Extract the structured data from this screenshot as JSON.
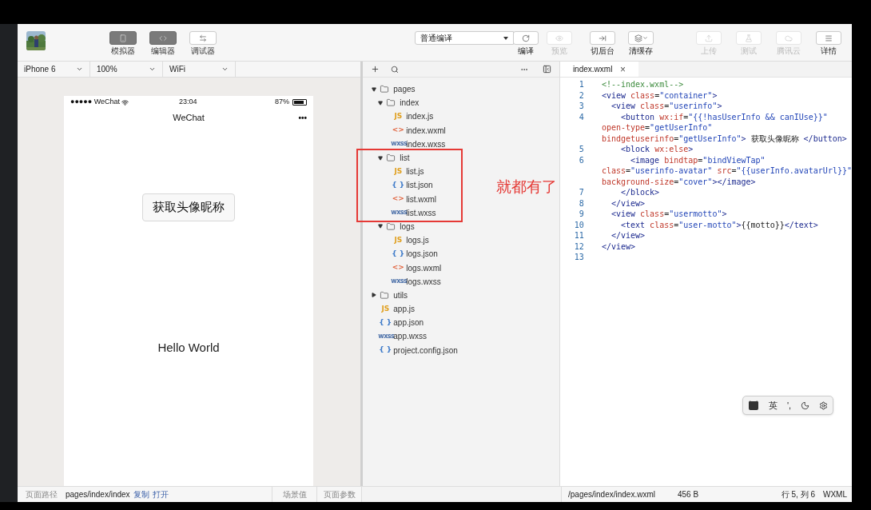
{
  "toolbar": {
    "views": [
      {
        "label": "模拟器",
        "on": true
      },
      {
        "label": "编辑器",
        "on": true
      },
      {
        "label": "调试器",
        "on": false
      }
    ],
    "compile_mode": "普通编译",
    "actions": [
      {
        "label": "编译",
        "disabled": false
      },
      {
        "label": "预览",
        "disabled": true
      },
      {
        "label": "切后台",
        "disabled": false
      },
      {
        "label": "清缓存",
        "disabled": false
      }
    ],
    "cloud": [
      {
        "label": "上传",
        "disabled": true
      },
      {
        "label": "测试",
        "disabled": true
      },
      {
        "label": "腾讯云",
        "disabled": true
      },
      {
        "label": "详情",
        "disabled": false
      }
    ]
  },
  "simulator": {
    "selects": [
      "iPhone 6",
      "100%",
      "WiFi"
    ],
    "phone": {
      "carrier": "●●●●● WeChat",
      "time": "23:04",
      "battery": "87%",
      "nav_title": "WeChat",
      "nav_more": "•••",
      "button": "获取头像昵称",
      "text": "Hello World"
    },
    "status": {
      "label": "页面路径",
      "path": "pages/index/index",
      "links": [
        "复制",
        "打开"
      ],
      "scene": "场景值",
      "params": "页面参数"
    }
  },
  "file_tree": [
    {
      "name": "pages",
      "kind": "folder",
      "expanded": true,
      "children": [
        {
          "name": "index",
          "kind": "folder",
          "expanded": true,
          "children": [
            {
              "name": "index.js",
              "kind": "js",
              "badge": "JS"
            },
            {
              "name": "index.wxml",
              "kind": "wxml",
              "badge": "<>"
            },
            {
              "name": "index.wxss",
              "kind": "wxss",
              "badge": "wxss"
            }
          ]
        },
        {
          "name": "list",
          "kind": "folder",
          "expanded": true,
          "children": [
            {
              "name": "list.js",
              "kind": "js",
              "badge": "JS"
            },
            {
              "name": "list.json",
              "kind": "json",
              "badge": "{ }"
            },
            {
              "name": "list.wxml",
              "kind": "wxml",
              "badge": "<>"
            },
            {
              "name": "list.wxss",
              "kind": "wxss",
              "badge": "wxss"
            }
          ]
        },
        {
          "name": "logs",
          "kind": "folder",
          "expanded": true,
          "children": [
            {
              "name": "logs.js",
              "kind": "js",
              "badge": "JS"
            },
            {
              "name": "logs.json",
              "kind": "json",
              "badge": "{ }"
            },
            {
              "name": "logs.wxml",
              "kind": "wxml",
              "badge": "<>"
            },
            {
              "name": "logs.wxss",
              "kind": "wxss",
              "badge": "wxss"
            }
          ]
        }
      ]
    },
    {
      "name": "utils",
      "kind": "folder",
      "expanded": false
    },
    {
      "name": "app.js",
      "kind": "js",
      "badge": "JS"
    },
    {
      "name": "app.json",
      "kind": "json",
      "badge": "{ }"
    },
    {
      "name": "app.wxss",
      "kind": "wxss",
      "badge": "wxss"
    },
    {
      "name": "project.config.json",
      "kind": "json",
      "badge": "{ }"
    }
  ],
  "annotation": {
    "text": "就都有了"
  },
  "editor": {
    "tab": {
      "title": "index.wxml",
      "close": "×"
    },
    "lines": [
      {
        "number": "1",
        "tokens": [
          {
            "kind": "comment",
            "text": "<!--index.wxml-->"
          }
        ]
      },
      {
        "number": "2",
        "tokens": [
          {
            "kind": "tag",
            "text": "<view "
          },
          {
            "kind": "attr",
            "text": "class"
          },
          {
            "kind": "plain",
            "text": "="
          },
          {
            "kind": "string",
            "text": "\"container\""
          },
          {
            "kind": "tag",
            "text": ">"
          }
        ]
      },
      {
        "number": "3",
        "tokens": [
          {
            "kind": "tag",
            "text": "  <view "
          },
          {
            "kind": "attr",
            "text": "class"
          },
          {
            "kind": "plain",
            "text": "="
          },
          {
            "kind": "string",
            "text": "\"userinfo\""
          },
          {
            "kind": "tag",
            "text": ">"
          }
        ]
      },
      {
        "number": "4",
        "tokens": [
          {
            "kind": "tag",
            "text": "    <button "
          },
          {
            "kind": "attr",
            "text": "wx:if"
          },
          {
            "kind": "plain",
            "text": "="
          },
          {
            "kind": "string",
            "text": "\"{{!hasUserInfo && canIUse}}\""
          }
        ]
      },
      {
        "tokens": [
          {
            "kind": "attr",
            "text": "open-type"
          },
          {
            "kind": "plain",
            "text": "="
          },
          {
            "kind": "string",
            "text": "\"getUserInfo\""
          }
        ]
      },
      {
        "tokens": [
          {
            "kind": "attr",
            "text": "bindgetuserinfo"
          },
          {
            "kind": "plain",
            "text": "="
          },
          {
            "kind": "string",
            "text": "\"getUserInfo\""
          },
          {
            "kind": "tag",
            "text": ">"
          },
          {
            "kind": "plain",
            "text": " 获取头像昵称 "
          },
          {
            "kind": "tag",
            "text": "</button>"
          }
        ]
      },
      {
        "number": "5",
        "tokens": [
          {
            "kind": "tag",
            "text": "    <block "
          },
          {
            "kind": "attr",
            "text": "wx:else"
          },
          {
            "kind": "tag",
            "text": ">"
          }
        ]
      },
      {
        "number": "6",
        "tokens": [
          {
            "kind": "tag",
            "text": "      <image "
          },
          {
            "kind": "attr",
            "text": "bindtap"
          },
          {
            "kind": "plain",
            "text": "="
          },
          {
            "kind": "string",
            "text": "\"bindViewTap\""
          }
        ]
      },
      {
        "tokens": [
          {
            "kind": "attr",
            "text": "class"
          },
          {
            "kind": "plain",
            "text": "="
          },
          {
            "kind": "string",
            "text": "\"userinfo-avatar\" "
          },
          {
            "kind": "attr",
            "text": "src"
          },
          {
            "kind": "plain",
            "text": "="
          },
          {
            "kind": "string",
            "text": "\"{{userInfo.avatarUrl}}\""
          }
        ]
      },
      {
        "tokens": [
          {
            "kind": "attr",
            "text": "background-size"
          },
          {
            "kind": "plain",
            "text": "="
          },
          {
            "kind": "string",
            "text": "\"cover\""
          },
          {
            "kind": "tag",
            "text": "></image>"
          }
        ]
      },
      {
        "number": "7",
        "tokens": [
          {
            "kind": "tag",
            "text": "    </block>"
          }
        ]
      },
      {
        "number": "8",
        "tokens": [
          {
            "kind": "tag",
            "text": "  </view>"
          }
        ]
      },
      {
        "number": "9",
        "tokens": [
          {
            "kind": "tag",
            "text": "  <view "
          },
          {
            "kind": "attr",
            "text": "class"
          },
          {
            "kind": "plain",
            "text": "="
          },
          {
            "kind": "string",
            "text": "\"usermotto\""
          },
          {
            "kind": "tag",
            "text": ">"
          }
        ]
      },
      {
        "number": "10",
        "tokens": [
          {
            "kind": "tag",
            "text": "    <text "
          },
          {
            "kind": "attr",
            "text": "class"
          },
          {
            "kind": "plain",
            "text": "="
          },
          {
            "kind": "string",
            "text": "\"user-motto\""
          },
          {
            "kind": "tag",
            "text": ">"
          },
          {
            "kind": "plain",
            "text": "{{motto}}"
          },
          {
            "kind": "tag",
            "text": "</text>"
          }
        ]
      },
      {
        "number": "11",
        "tokens": [
          {
            "kind": "tag",
            "text": "  </view>"
          }
        ]
      },
      {
        "number": "12",
        "tokens": [
          {
            "kind": "tag",
            "text": "</view>"
          }
        ]
      },
      {
        "number": "13"
      }
    ],
    "ime": {
      "keys": [
        "英",
        "',"
      ]
    },
    "status": {
      "path": "/pages/index/index.wxml",
      "size": "456 B",
      "position": "行 5, 列 6",
      "language": "WXML"
    }
  }
}
